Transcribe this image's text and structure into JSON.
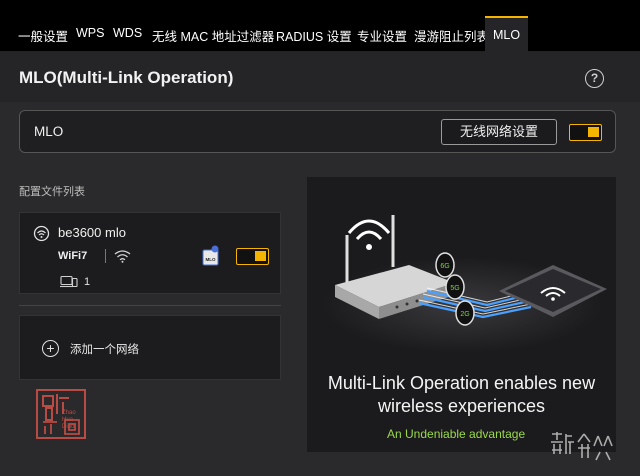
{
  "tabs": [
    {
      "label": "一般设置"
    },
    {
      "label": "WPS"
    },
    {
      "label": "WDS"
    },
    {
      "label": "无线 MAC 地址过滤器"
    },
    {
      "label": "RADIUS 设置"
    },
    {
      "label": "专业设置"
    },
    {
      "label": "漫游阻止列表"
    },
    {
      "label": "MLO",
      "active": true
    }
  ],
  "page": {
    "title": "MLO(Multi-Link Operation)",
    "help_icon": "question-icon",
    "help_glyph": "?"
  },
  "mlo": {
    "label": "MLO",
    "button_label": "无线网络设置",
    "enabled": true
  },
  "profiles": {
    "section_label": "配置文件列表",
    "items": [
      {
        "name": "be3600 mlo",
        "wifi_badge": "WiFi7",
        "mlo_badge": "MLO",
        "client_count": "1",
        "enabled": true
      }
    ],
    "add_label": "添加一个网络"
  },
  "promo": {
    "title": "Multi-Link Operation enables new wireless experiences",
    "subtitle": "An Undeniable advantage",
    "band_labels": [
      "6G",
      "5G",
      "2G"
    ]
  },
  "stamp": {
    "text": "昭华凋",
    "name_lines": [
      "Zhao",
      "Hua",
      "Diao"
    ]
  },
  "watermark": "新浪众测",
  "colors": {
    "accent": "#f5b400",
    "subtitle_green": "#9ad84a",
    "stamp_red": "#b84b44"
  }
}
